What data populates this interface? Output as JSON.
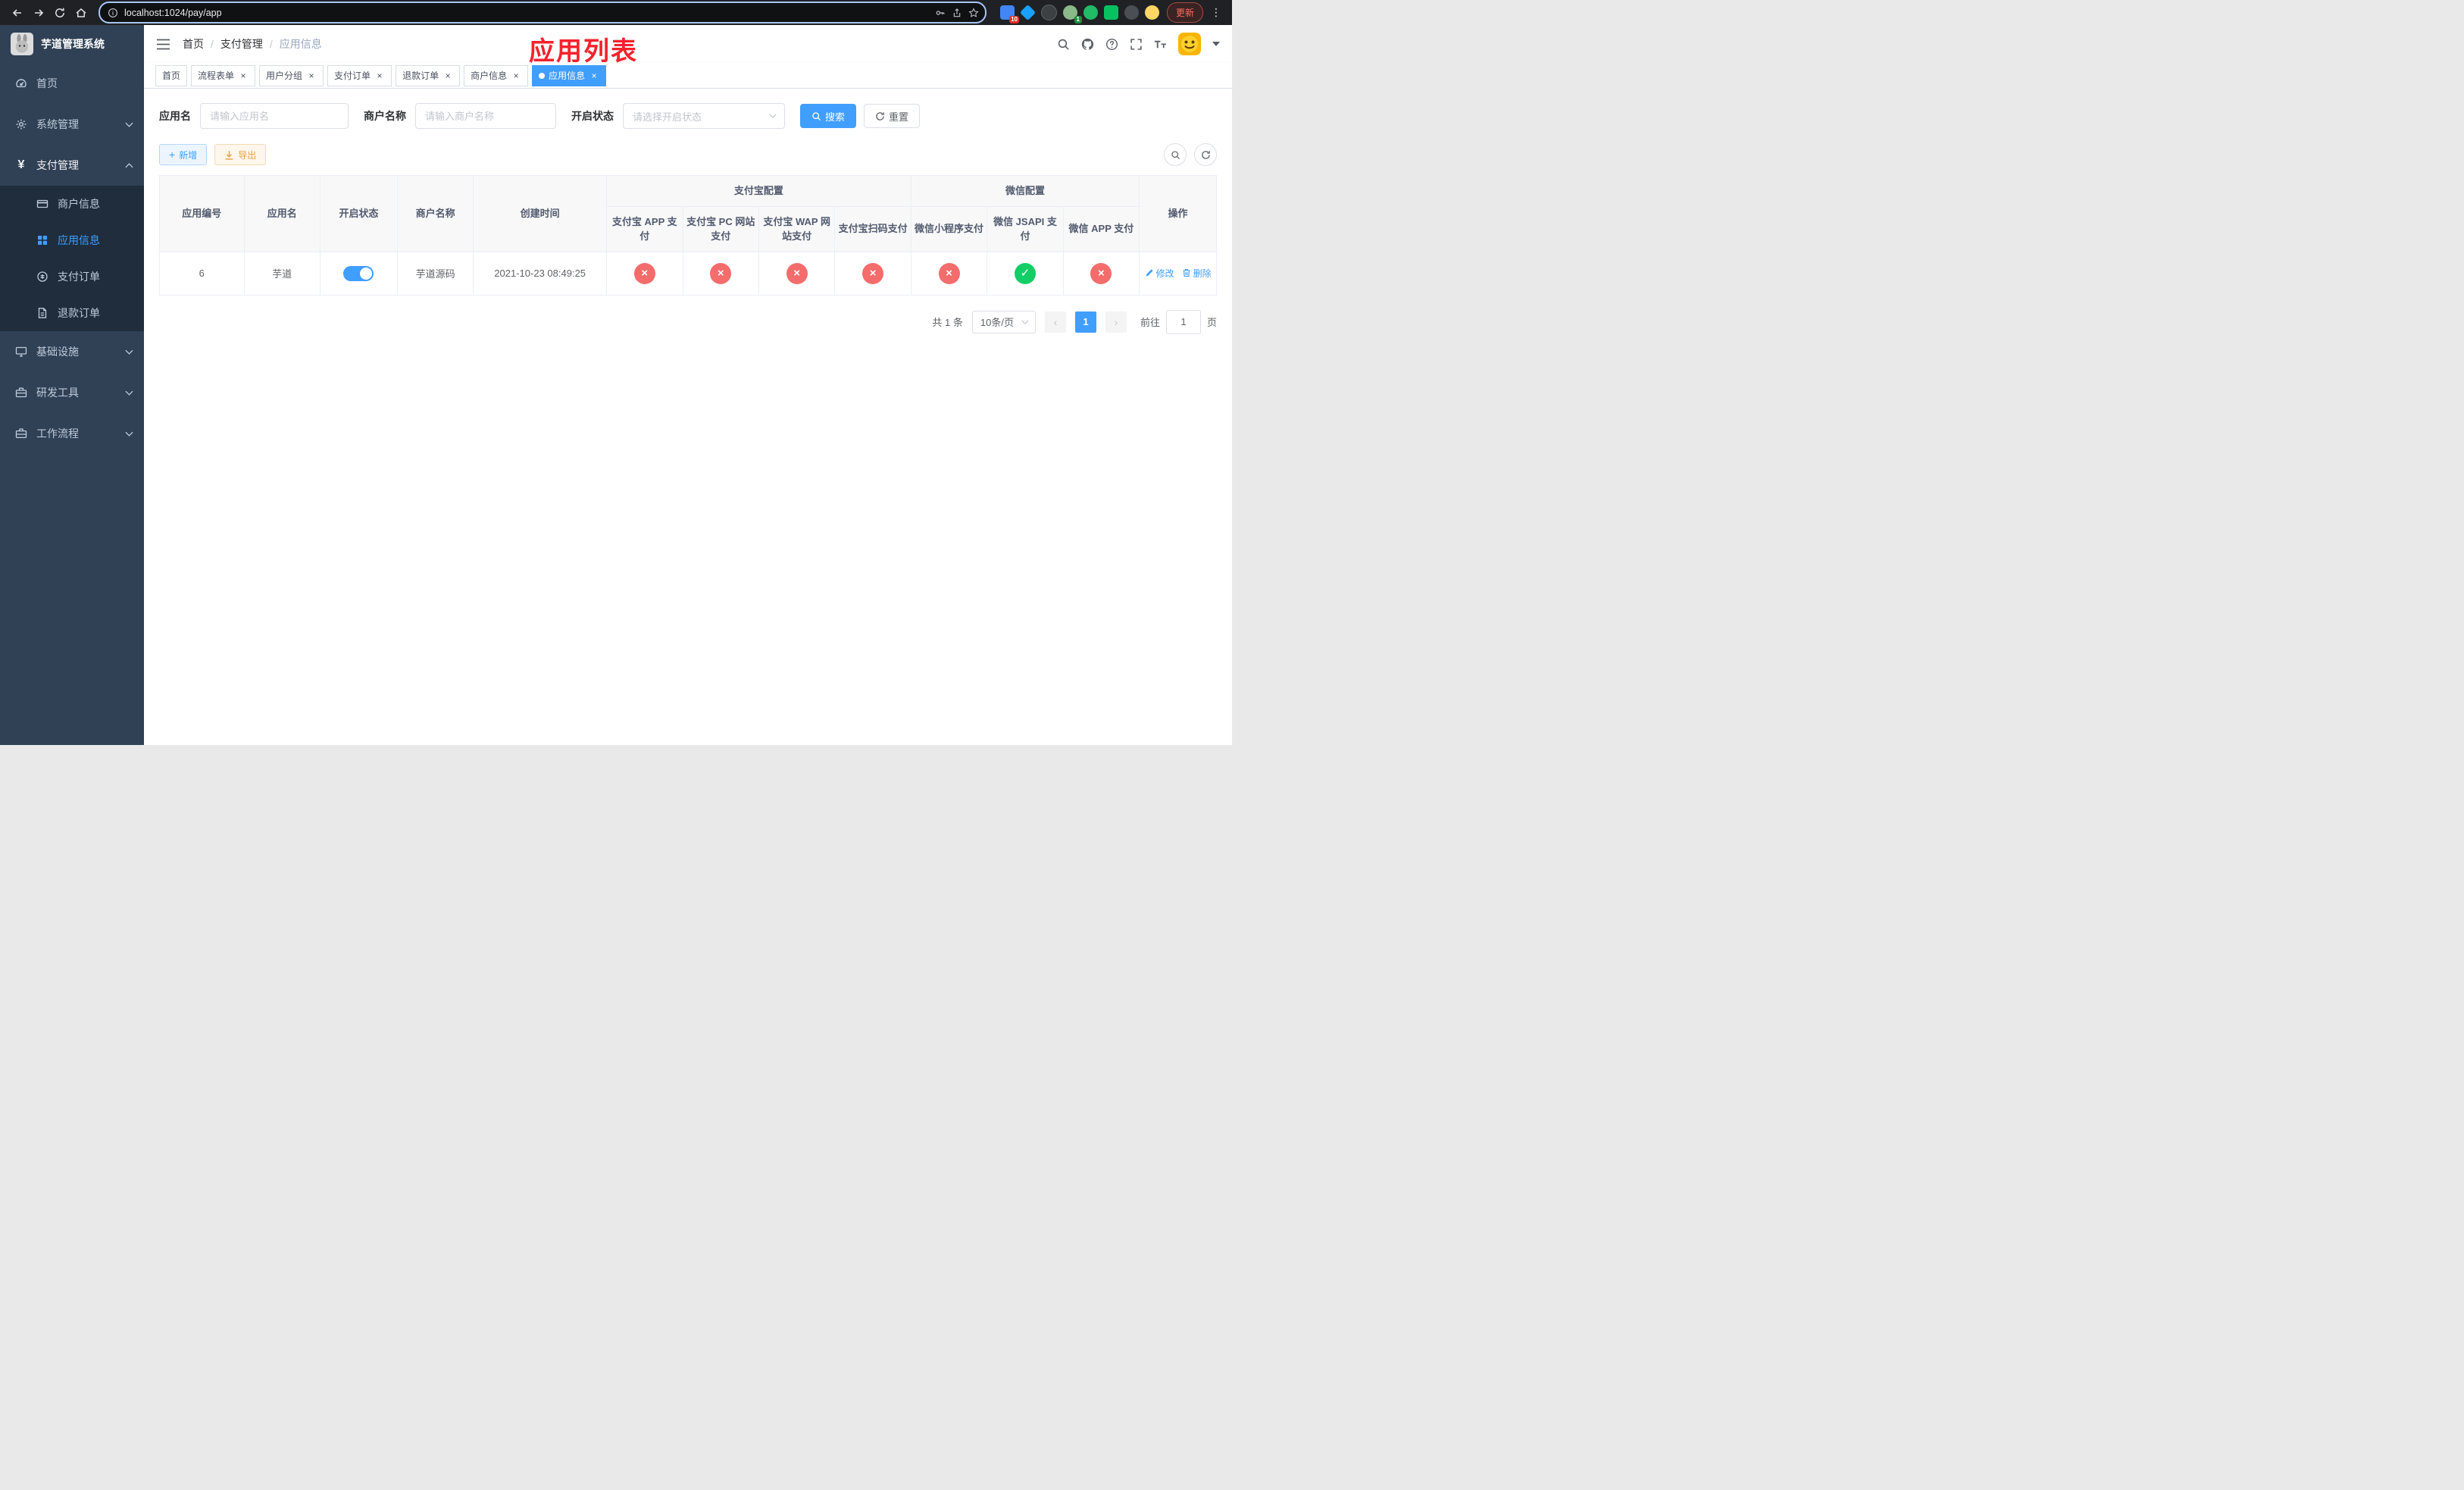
{
  "browser": {
    "url": "localhost:1024/pay/app",
    "update_button": "更新",
    "ext_badge_count": "10",
    "profile_badge_count": "1"
  },
  "sidebar": {
    "title": "芋道管理系统",
    "home": "首页",
    "system": "系统管理",
    "payment": "支付管理",
    "merchant_info": "商户信息",
    "app_info": "应用信息",
    "pay_order": "支付订单",
    "refund_order": "退款订单",
    "infrastructure": "基础设施",
    "dev_tools": "研发工具",
    "workflow": "工作流程"
  },
  "navbar": {
    "breadcrumb": [
      "首页",
      "支付管理",
      "应用信息"
    ],
    "annotation": "应用列表"
  },
  "tabs": [
    {
      "label": "首页"
    },
    {
      "label": "流程表单"
    },
    {
      "label": "用户分组"
    },
    {
      "label": "支付订单"
    },
    {
      "label": "退款订单"
    },
    {
      "label": "商户信息"
    },
    {
      "label": "应用信息"
    }
  ],
  "filters": {
    "app_name_label": "应用名",
    "app_name_placeholder": "请输入应用名",
    "merchant_label": "商户名称",
    "merchant_placeholder": "请输入商户名称",
    "status_label": "开启状态",
    "status_placeholder": "请选择开启状态",
    "search_button": "搜索",
    "reset_button": "重置"
  },
  "toolbar": {
    "add_button": "新增",
    "export_button": "导出"
  },
  "table": {
    "headers": {
      "app_id": "应用编号",
      "app_name": "应用名",
      "status": "开启状态",
      "merchant_name": "商户名称",
      "created_at": "创建时间",
      "alipay_group": "支付宝配置",
      "wechat_group": "微信配置",
      "alipay_app": "支付宝 APP 支付",
      "alipay_pc": "支付宝 PC 网站支付",
      "alipay_wap": "支付宝 WAP 网站支付",
      "alipay_scan": "支付宝扫码支付",
      "wechat_mini": "微信小程序支付",
      "wechat_jsapi": "微信 JSAPI 支付",
      "wechat_app": "微信 APP 支付",
      "actions": "操作"
    },
    "rows": [
      {
        "app_id": "6",
        "app_name": "芋道",
        "enabled": true,
        "merchant_name": "芋道源码",
        "created_at": "2021-10-23 08:49:25",
        "alipay_app": false,
        "alipay_pc": false,
        "alipay_wap": false,
        "alipay_scan": false,
        "wechat_mini": false,
        "wechat_jsapi": true,
        "wechat_app": false,
        "edit_label": "修改",
        "delete_label": "删除"
      }
    ]
  },
  "pagination": {
    "total": "共 1 条",
    "page_size": "10条/页",
    "page": "1",
    "goto_label": "前往",
    "goto_value": "1",
    "page_unit": "页"
  },
  "colors": {
    "primary": "#409eff",
    "success": "#13ce66",
    "danger": "#f56c6c",
    "annotation_red": "#f5222d"
  }
}
